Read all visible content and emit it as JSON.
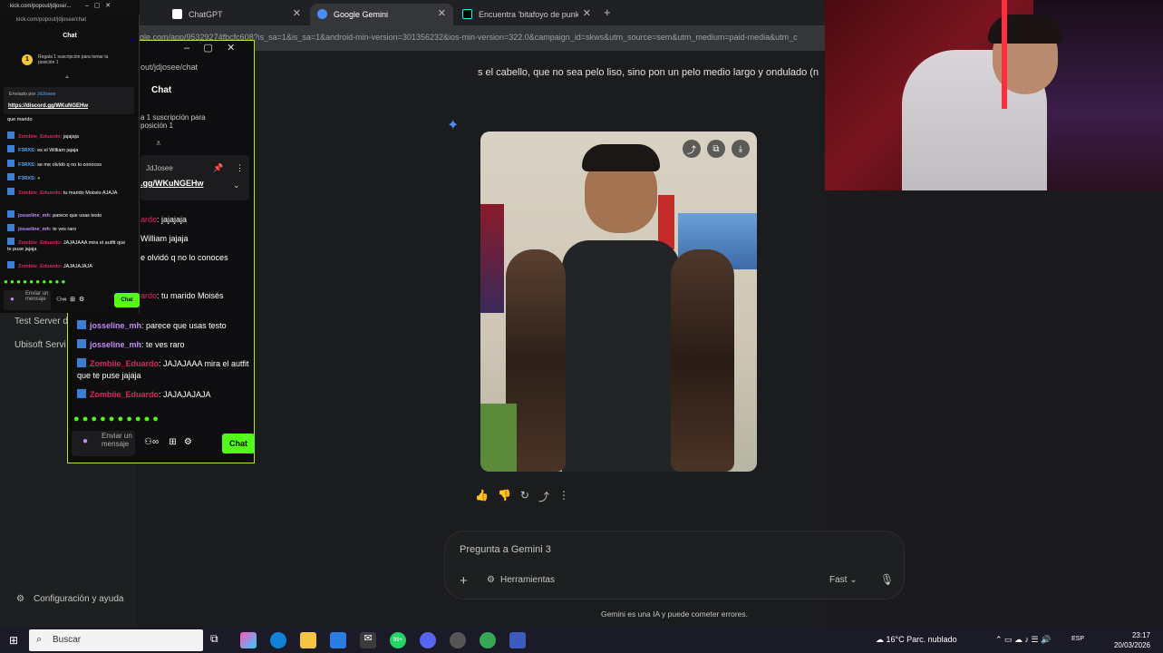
{
  "browser": {
    "tabs": [
      {
        "label": "ChatGPT",
        "active": false
      },
      {
        "label": "Google Gemini",
        "active": true
      },
      {
        "label": "Encuentra 'bitafoyo de punk' en ...",
        "active": false
      }
    ],
    "url": "gle.com/app/95329274fbcfc608?is_sa=1&is_sa=1&android-min-version=301356232&ios-min-version=322.0&campaign_id=skws&utm_source=sem&utm_medium=paid-media&utm_c"
  },
  "gemini": {
    "prompt_text": "s el cabello, que no sea pelo liso, sino pon un pelo medio largo y ondulado (n",
    "input_placeholder": "Pregunta a Gemini 3",
    "tools_label": "Herramientas",
    "fast_label": "Fast",
    "disclaimer": "Gemini es una IA y puede cometer errores.",
    "config_label": "Configuración y ayuda",
    "side_items": [
      "Test Server d",
      "Ubisoft Servi"
    ]
  },
  "kick_small": {
    "window_title": "kick.com/popout/jdjose/...",
    "url": "kick.com/popout/jdjosee/chat",
    "chat_header": "Chat",
    "sub_goal": "Regala 1 suscripción para tomar la posición 1",
    "pinned_by": "Enviado por",
    "pinned_user": "JdJosee",
    "pinned_link": "https://discord.gg/WKuNGEHw",
    "messages": [
      {
        "user": "",
        "text": "que marido"
      },
      {
        "user": "Zombiie_Eduardo:",
        "text": "jajajaja"
      },
      {
        "user": "F3RXS:",
        "text": "es el William jajaja"
      },
      {
        "user": "F3RXS:",
        "text": "se me olvidó q no lo conoces"
      },
      {
        "user": "F3RXS:",
        "text": ""
      },
      {
        "user": "Zombiie_Eduardo:",
        "text": "tu marido Moisés AJAJA"
      },
      {
        "user": "josseline_mh:",
        "text": "parece que usas testo"
      },
      {
        "user": "josseline_mh:",
        "text": "te ves raro"
      },
      {
        "user": "Zombiie_Eduardo:",
        "text": "JAJAJAAA mira el autfit que te puse jajaja"
      },
      {
        "user": "Zombiie_Eduardo:",
        "text": "JAJAJAJAJA"
      }
    ],
    "send_placeholder": "Enviar un mensaje",
    "chat_button": "Chat"
  },
  "kick_big": {
    "url": "out/jdjosee/chat",
    "chat_header": "Chat",
    "sub_goal_line1": "a 1 suscripción para",
    "sub_goal_line2": "posición 1",
    "pinned_user": "JdJosee",
    "pinned_link": ".gg/WKuNGEHw",
    "partial_lines": [
      {
        "user": "ardo",
        "text": ": jajajaja"
      },
      {
        "user": "",
        "text": "William jajaja"
      },
      {
        "user": "",
        "text": "e olvidó q no lo conoces"
      },
      {
        "user": "ardo",
        "text": ": tu marido Moisés"
      }
    ],
    "messages": [
      {
        "user": "josseline_mh",
        "text": ": parece que usas testo"
      },
      {
        "user": "josseline_mh",
        "text": ": te ves raro"
      },
      {
        "user": "Zombiie_Eduardo",
        "text": ": JAJAJAAA mira el autfit que te puse jajaja"
      },
      {
        "user": "Zombiie_Eduardo",
        "text": ": JAJAJAJAJA"
      }
    ],
    "send_placeholder": "Enviar un mensaje",
    "chat_button": "Chat"
  },
  "taskbar": {
    "search_placeholder": "Buscar",
    "weather": "16°C  Parc. nublado",
    "lang": "ESP",
    "time": "23:17",
    "date": "20/03/2026",
    "whatsapp_badge": "99+"
  },
  "colors": {
    "kick_green": "#53fc18",
    "gemini_blue": "#4b8cf5",
    "username_red": "#e0245e",
    "username_purple": "#c38bff",
    "username_blue": "#5aa7ff"
  }
}
